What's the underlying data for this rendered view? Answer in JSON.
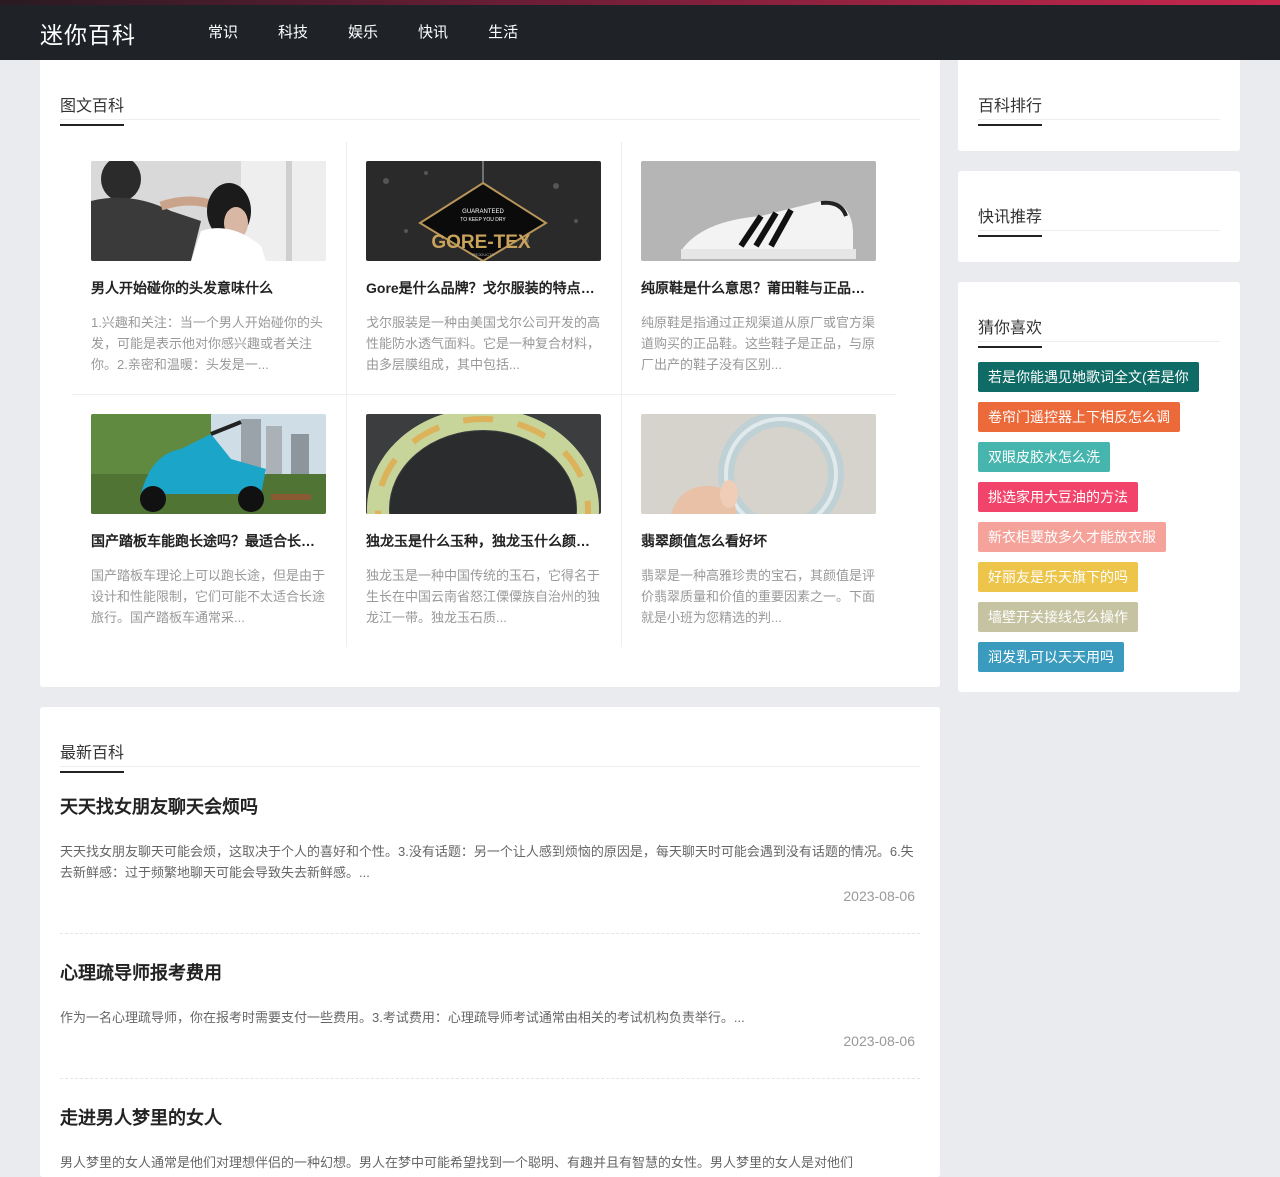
{
  "header": {
    "logo": "迷你百科",
    "nav": [
      "常识",
      "科技",
      "娱乐",
      "快讯",
      "生活"
    ]
  },
  "picture_section": {
    "title": "图文百科",
    "items": [
      {
        "title": "男人开始碰你的头发意味什么",
        "desc": "1.兴趣和关注：当一个男人开始碰你的头发，可能是表示他对你感兴趣或者关注你。2.亲密和温暖：头发是一...",
        "image": "couple-hair-photo"
      },
      {
        "title": "Gore是什么品牌？戈尔服装的特点是什么",
        "desc": "戈尔服装是一种由美国戈尔公司开发的高性能防水透气面料。它是一种复合材料，由多层膜组成，其中包括...",
        "image": "goretex-tag-photo",
        "tag_line1": "GUARANTEED",
        "tag_line2": "TO KEEP YOU DRY",
        "tag_brand": "GORE-TEX",
        "tag_sub": "PRODUCTS"
      },
      {
        "title": "纯原鞋是什么意思？莆田鞋与正品的区别",
        "desc": "纯原鞋是指通过正规渠道从原厂或官方渠道购买的正品鞋。这些鞋子是正品，与原厂出产的鞋子没有区别...",
        "image": "sneaker-photo"
      },
      {
        "title": "国产踏板车能跑长途吗？最适合长途的踏板车",
        "desc": "国产踏板车理论上可以跑长途，但是由于设计和性能限制，它们可能不太适合长途旅行。国产踏板车通常采...",
        "image": "scooter-photo"
      },
      {
        "title": "独龙玉是什么玉种，独龙玉什么颜色最好",
        "desc": "独龙玉是一种中国传统的玉石，它得名于生长在中国云南省怒江傈僳族自治州的独龙江一带。独龙玉石质...",
        "image": "jade-bangle-photo"
      },
      {
        "title": "翡翠颜值怎么看好坏",
        "desc": "翡翠是一种高雅珍贵的宝石，其颜值是评价翡翠质量和价值的重要因素之一。下面就是小班为您精选的判...",
        "image": "jade-bracelet-hand-photo"
      }
    ]
  },
  "latest_section": {
    "title": "最新百科",
    "articles": [
      {
        "title": "天天找女朋友聊天会烦吗",
        "desc": "天天找女朋友聊天可能会烦，这取决于个人的喜好和个性。3.没有话题：另一个让人感到烦恼的原因是，每天聊天时可能会遇到没有话题的情况。6.失去新鲜感：过于频繁地聊天可能会导致失去新鲜感。...",
        "date": "2023-08-06"
      },
      {
        "title": "心理疏导师报考费用",
        "desc": "作为一名心理疏导师，你在报考时需要支付一些费用。3.考试费用：心理疏导师考试通常由相关的考试机构负责举行。...",
        "date": "2023-08-06"
      },
      {
        "title": "走进男人梦里的女人",
        "desc": "男人梦里的女人通常是他们对理想伴侣的一种幻想。男人在梦中可能希望找到一个聪明、有趣并且有智慧的女性。男人梦里的女人是对他们"
      }
    ]
  },
  "sidebar": {
    "ranking_title": "百科排行",
    "news_title": "快讯推荐",
    "guess_title": "猜你喜欢",
    "tags": [
      {
        "label": "若是你能遇见她歌词全文(若是你",
        "color": "#0f6b65"
      },
      {
        "label": "卷帘门遥控器上下相反怎么调",
        "color": "#ec6a3a"
      },
      {
        "label": "双眼皮胶水怎么洗",
        "color": "#45b5ad"
      },
      {
        "label": "挑选家用大豆油的方法",
        "color": "#f2436a"
      },
      {
        "label": "新衣柜要放多久才能放衣服",
        "color": "#f5a29a"
      },
      {
        "label": "好丽友是乐天旗下的吗",
        "color": "#ecc54a"
      },
      {
        "label": "墙壁开关接线怎么操作",
        "color": "#c5c3a2"
      },
      {
        "label": "润发乳可以天天用吗",
        "color": "#3a9bbf"
      }
    ]
  }
}
